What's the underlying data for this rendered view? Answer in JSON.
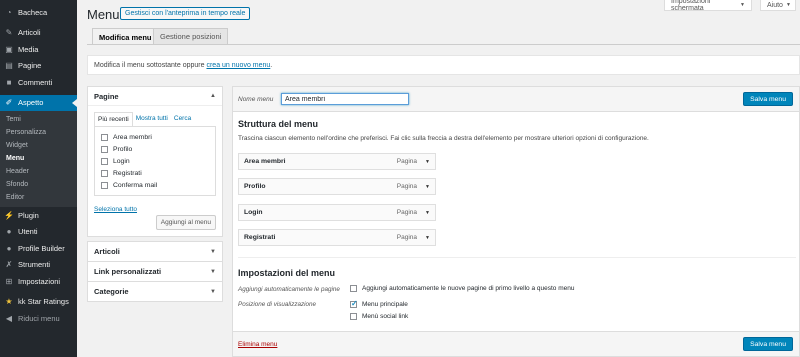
{
  "sidebar": {
    "items": [
      {
        "label": "Bacheca",
        "icon": "dashboard-icon"
      },
      {
        "label": "Articoli",
        "icon": "pin-icon"
      },
      {
        "label": "Media",
        "icon": "media-icon"
      },
      {
        "label": "Pagine",
        "icon": "page-icon"
      },
      {
        "label": "Commenti",
        "icon": "comment-icon"
      },
      {
        "label": "Aspetto",
        "icon": "brush-icon"
      }
    ],
    "submenu": [
      "Temi",
      "Personalizza",
      "Widget",
      "Menu",
      "Header",
      "Sfondo",
      "Editor"
    ],
    "items_after": [
      {
        "label": "Plugin",
        "icon": "plugin-icon"
      },
      {
        "label": "Utenti",
        "icon": "users-icon"
      },
      {
        "label": "Profile Builder",
        "icon": "profile-builder-icon"
      },
      {
        "label": "Strumenti",
        "icon": "wrench-icon"
      },
      {
        "label": "Impostazioni",
        "icon": "settings-icon"
      },
      {
        "label": "kk Star Ratings",
        "icon": "star-icon"
      },
      {
        "label": "Riduci menu",
        "icon": "collapse-icon"
      }
    ]
  },
  "screen_options": {
    "label": "Impostazioni schermata"
  },
  "help": {
    "label": "Aiuto"
  },
  "header": {
    "title": "Menu",
    "preview_button": "Gestisci con l'anteprima in tempo reale"
  },
  "tabs": [
    "Modifica menu",
    "Gestione posizioni"
  ],
  "notice": {
    "text": "Modifica il menu sottostante oppure ",
    "link": "crea un nuovo menu",
    "suffix": "."
  },
  "left": {
    "pages": {
      "title": "Pagine",
      "subtabs": [
        "Più recenti",
        "Mostra tutti",
        "Cerca"
      ],
      "items": [
        "Area membri",
        "Profilo",
        "Login",
        "Registrati",
        "Conferma mail"
      ],
      "select_all": "Seleziona tutto",
      "add_button": "Aggiungi al menu"
    },
    "sections": [
      "Articoli",
      "Link personalizzati",
      "Categorie"
    ]
  },
  "main": {
    "name_label": "Nome menu",
    "name_value": "Area membri",
    "save_label": "Salva menu",
    "structure_title": "Struttura del menu",
    "structure_desc": "Trascina ciascun elemento nell'ordine che preferisci. Fai clic sulla freccia a destra dell'elemento per mostrare ulteriori opzioni di configurazione.",
    "menu_items": [
      {
        "title": "Area membri",
        "type": "Pagina"
      },
      {
        "title": "Profilo",
        "type": "Pagina"
      },
      {
        "title": "Login",
        "type": "Pagina"
      },
      {
        "title": "Registrati",
        "type": "Pagina"
      }
    ],
    "settings": {
      "title": "Impostazioni del menu",
      "auto_label": "Aggiungi automaticamente le pagine",
      "auto_option": "Aggiungi automaticamente le nuove pagine di primo livello a questo menu",
      "auto_checked": false,
      "position_label": "Posizione di visualizzazione",
      "positions": [
        {
          "label": "Menu principale",
          "checked": true
        },
        {
          "label": "Menù social link",
          "checked": false
        }
      ]
    },
    "delete_label": "Elimina menu"
  }
}
